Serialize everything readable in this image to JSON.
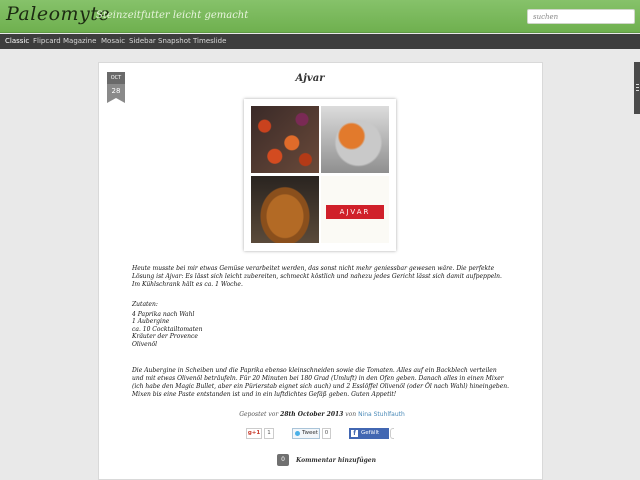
{
  "header": {
    "logo": "Paleomyte",
    "tagline": "Steinzeitfutter leicht gemacht",
    "search_placeholder": "suchen"
  },
  "nav": {
    "items": [
      "Classic",
      "Flipcard",
      "Magazine",
      "Mosaic",
      "Sidebar",
      "Snapshot",
      "Timeslide"
    ],
    "active": "Classic"
  },
  "post": {
    "date_month": "OCT",
    "date_day": "28",
    "title": "Ajvar",
    "image_label": "AJVAR",
    "intro": "Heute musste bei mir etwas Gemüse verarbeitet werden, das sonst nicht mehr geniessbar gewesen wäre. Die perfekte Lösung ist Ajvar: Es lässt sich leicht zubereiten, schmeckt köstlich und nahezu jedes Gericht lässt sich damit aufpeppeln. Im Kühlschrank hält es ca. 1 Woche.",
    "ingredients_heading": "Zutaten:",
    "ingredients": [
      "4 Paprika nach Wahl",
      "1 Aubergine",
      "ca. 10 Cocktailtomaten",
      "Kräuter der Provence",
      "Olivenöl"
    ],
    "method": "Die Aubergine in Scheiben und die Paprika ebenso kleinschneiden sowie die Tomaten. Alles auf ein Backblech verteilen und mit etwas Olivenöl beträufeln. Für 20 Minuten bei 180 Grad (Umluft) in den Ofen geben. Danach alles in einen Mixer (ich habe den Magic Bullet, aber ein Pürierstab eignet sich auch) und 2 Esslöffel Olivenöl (oder Öl nach Wahl) hineingeben. Mixen bis eine Paste entstanden ist und in ein luftdichtes Gefäß geben. Guten Appetit!",
    "posted_prefix": "Gepostet vor",
    "posted_date": "28th October 2013",
    "posted_by": "von",
    "author": "Nina Stuhlfauth"
  },
  "share": {
    "gplus_label": "g+1",
    "gplus_count": "1",
    "tweet_label": "Tweet",
    "tweet_count": "0",
    "fb_label": "Gefällt mir",
    "fb_count": ""
  },
  "comments": {
    "icon_text": "0",
    "link_label": "Kommentar hinzufügen"
  },
  "colors": {
    "header_green": "#7ab95c",
    "nav_bg": "#3d3d3d",
    "ajvar_red": "#d0202a",
    "author_blue": "#4a8ab8",
    "facebook_blue": "#4267b2"
  }
}
